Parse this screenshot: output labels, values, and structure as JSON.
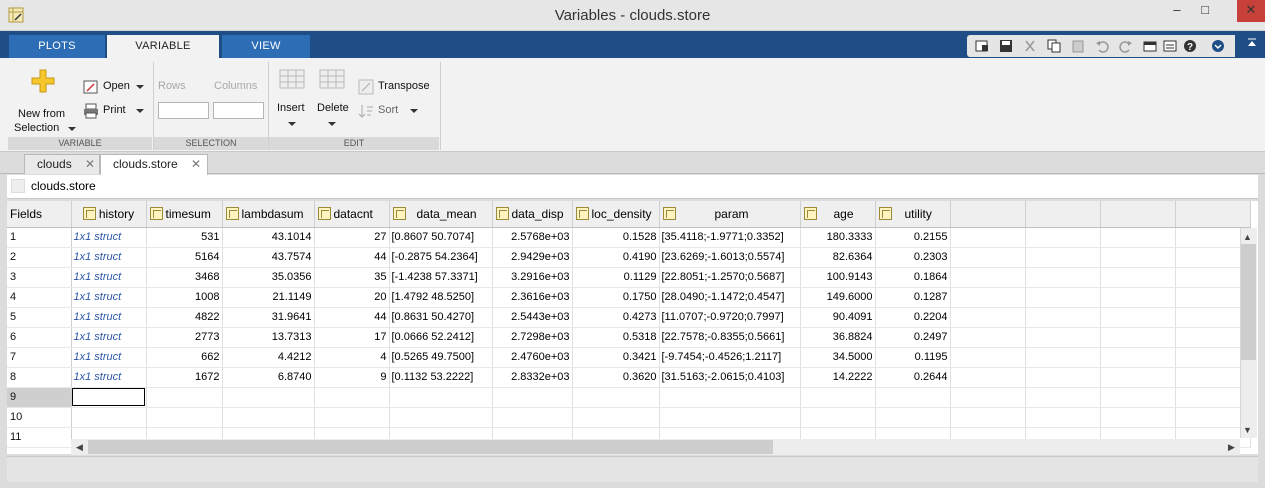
{
  "window": {
    "title": "Variables - clouds.store",
    "controls": {
      "minimize": "–",
      "maximize": "□",
      "close": "✕"
    }
  },
  "ribbon_tabs": [
    {
      "label": "PLOTS"
    },
    {
      "label": "VARIABLE"
    },
    {
      "label": "VIEW"
    }
  ],
  "ribbon": {
    "new_from_selection": {
      "line1": "New from",
      "line2": "Selection"
    },
    "open": "Open",
    "print": "Print",
    "rows": "Rows",
    "columns": "Columns",
    "insert": "Insert",
    "delete": "Delete",
    "transpose": "Transpose",
    "sort": "Sort",
    "groups": {
      "variable": "VARIABLE",
      "selection": "SELECTION",
      "edit": "EDIT"
    }
  },
  "doc_tabs": [
    {
      "label": "clouds",
      "close": "✕"
    },
    {
      "label": "clouds.store",
      "close": "✕"
    }
  ],
  "path": "clouds.store",
  "table": {
    "corner": "Fields",
    "headers": [
      "history",
      "timesum",
      "lambdasum",
      "datacnt",
      "data_mean",
      "data_disp",
      "loc_density",
      "param",
      "age",
      "utility"
    ],
    "rows": [
      [
        "1",
        "1x1 struct",
        "531",
        "43.1014",
        "27",
        "[0.8607 50.7074]",
        "2.5768e+03",
        "0.1528",
        "[35.4118;-1.9771;0.3352]",
        "180.3333",
        "0.2155"
      ],
      [
        "2",
        "1x1 struct",
        "5164",
        "43.7574",
        "44",
        "[-0.2875 54.2364]",
        "2.9429e+03",
        "0.4190",
        "[23.6269;-1.6013;0.5574]",
        "82.6364",
        "0.2303"
      ],
      [
        "3",
        "1x1 struct",
        "3468",
        "35.0356",
        "35",
        "[-1.4238 57.3371]",
        "3.2916e+03",
        "0.1129",
        "[22.8051;-1.2570;0.5687]",
        "100.9143",
        "0.1864"
      ],
      [
        "4",
        "1x1 struct",
        "1008",
        "21.1149",
        "20",
        "[1.4792 48.5250]",
        "2.3616e+03",
        "0.1750",
        "[28.0490;-1.1472;0.4547]",
        "149.6000",
        "0.1287"
      ],
      [
        "5",
        "1x1 struct",
        "4822",
        "31.9641",
        "44",
        "[0.8631 50.4270]",
        "2.5443e+03",
        "0.4273",
        "[11.0707;-0.9720;0.7997]",
        "90.4091",
        "0.2204"
      ],
      [
        "6",
        "1x1 struct",
        "2773",
        "13.7313",
        "17",
        "[0.0666 52.2412]",
        "2.7298e+03",
        "0.5318",
        "[22.7578;-0.8355;0.5661]",
        "36.8824",
        "0.2497"
      ],
      [
        "7",
        "1x1 struct",
        "662",
        "4.4212",
        "4",
        "[0.5265 49.7500]",
        "2.4760e+03",
        "0.3421",
        "[-9.7454;-0.4526;1.2117]",
        "34.5000",
        "0.1195"
      ],
      [
        "8",
        "1x1 struct",
        "1672",
        "6.8740",
        "9",
        "[0.1132 53.2222]",
        "2.8332e+03",
        "0.3620",
        "[31.5163;-2.0615;0.4103]",
        "14.2222",
        "0.2644"
      ],
      [
        "9",
        "",
        "",
        "",
        "",
        "",
        "",
        "",
        "",
        "",
        ""
      ],
      [
        "10",
        "",
        "",
        "",
        "",
        "",
        "",
        "",
        "",
        "",
        ""
      ],
      [
        "11",
        "",
        "",
        "",
        "",
        "",
        "",
        "",
        "",
        "",
        ""
      ]
    ]
  }
}
